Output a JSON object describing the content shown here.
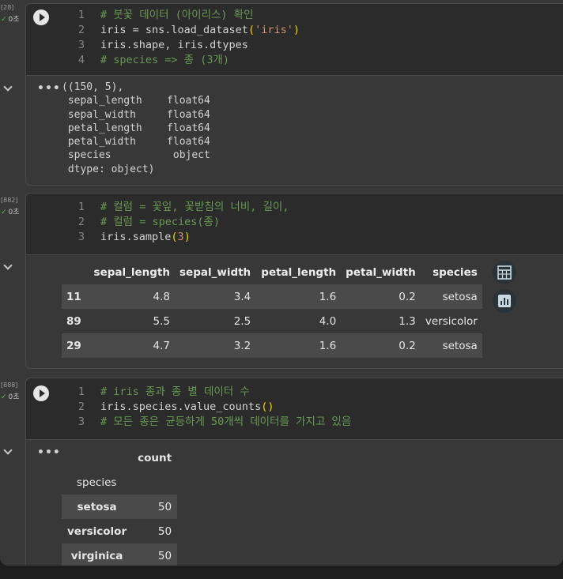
{
  "cells": [
    {
      "count_label": "[28]",
      "time": "0초",
      "lines": [
        {
          "n": "1",
          "parts": [
            {
              "t": "# 붓꽃 데이터 (아이리스) 확인",
              "c": "cm"
            }
          ]
        },
        {
          "n": "2",
          "parts": [
            {
              "t": "iris = sns.load_dataset",
              "c": "tx"
            },
            {
              "t": "(",
              "c": "par"
            },
            {
              "t": "'iris'",
              "c": "str"
            },
            {
              "t": ")",
              "c": "par"
            }
          ]
        },
        {
          "n": "3",
          "parts": [
            {
              "t": "iris.shape, iris.dtypes",
              "c": "tx"
            }
          ]
        },
        {
          "n": "4",
          "parts": [
            {
              "t": "# species => 종 (3개)",
              "c": "cm"
            }
          ]
        }
      ],
      "output_text": "((150, 5),\n sepal_length    float64\n sepal_width     float64\n petal_length    float64\n petal_width     float64\n species          object\n dtype: object)"
    },
    {
      "count_label": "[882]",
      "time": "0초",
      "lines": [
        {
          "n": "1",
          "parts": [
            {
              "t": "# 컬럼 = 꽃잎, 꽃받침의 너비, 길이,",
              "c": "cm"
            }
          ]
        },
        {
          "n": "2",
          "parts": [
            {
              "t": "# 컬럼 = species(종)",
              "c": "cm"
            }
          ]
        },
        {
          "n": "3",
          "parts": [
            {
              "t": "iris.sample",
              "c": "tx"
            },
            {
              "t": "(",
              "c": "par"
            },
            {
              "t": "3",
              "c": "str"
            },
            {
              "t": ")",
              "c": "par"
            }
          ]
        }
      ],
      "table": {
        "columns": [
          "",
          "sepal_length",
          "sepal_width",
          "petal_length",
          "petal_width",
          "species"
        ],
        "rows": [
          [
            "11",
            "4.8",
            "3.4",
            "1.6",
            "0.2",
            "setosa"
          ],
          [
            "89",
            "5.5",
            "2.5",
            "4.0",
            "1.3",
            "versicolor"
          ],
          [
            "29",
            "4.7",
            "3.2",
            "1.6",
            "0.2",
            "setosa"
          ]
        ]
      }
    },
    {
      "count_label": "[888]",
      "time": "0초",
      "lines": [
        {
          "n": "1",
          "parts": [
            {
              "t": "# iris 종과 종 별 데이터 수",
              "c": "cm"
            }
          ]
        },
        {
          "n": "2",
          "parts": [
            {
              "t": "iris.species.value_counts",
              "c": "tx"
            },
            {
              "t": "()",
              "c": "par"
            }
          ]
        },
        {
          "n": "3",
          "parts": [
            {
              "t": "# 모든 종은 균등하게 50개씩 데이터를 가지고 있음",
              "c": "cm"
            }
          ]
        }
      ],
      "value_counts": {
        "header": "count",
        "index_name": "species",
        "rows": [
          [
            "setosa",
            "50"
          ],
          [
            "versicolor",
            "50"
          ],
          [
            "virginica",
            "50"
          ]
        ]
      }
    }
  ],
  "icons": {
    "run": "play-icon",
    "more": "more-options-icon",
    "collapse": "chevron-down-icon",
    "table": "table-icon",
    "chart": "bar-chart-icon"
  }
}
